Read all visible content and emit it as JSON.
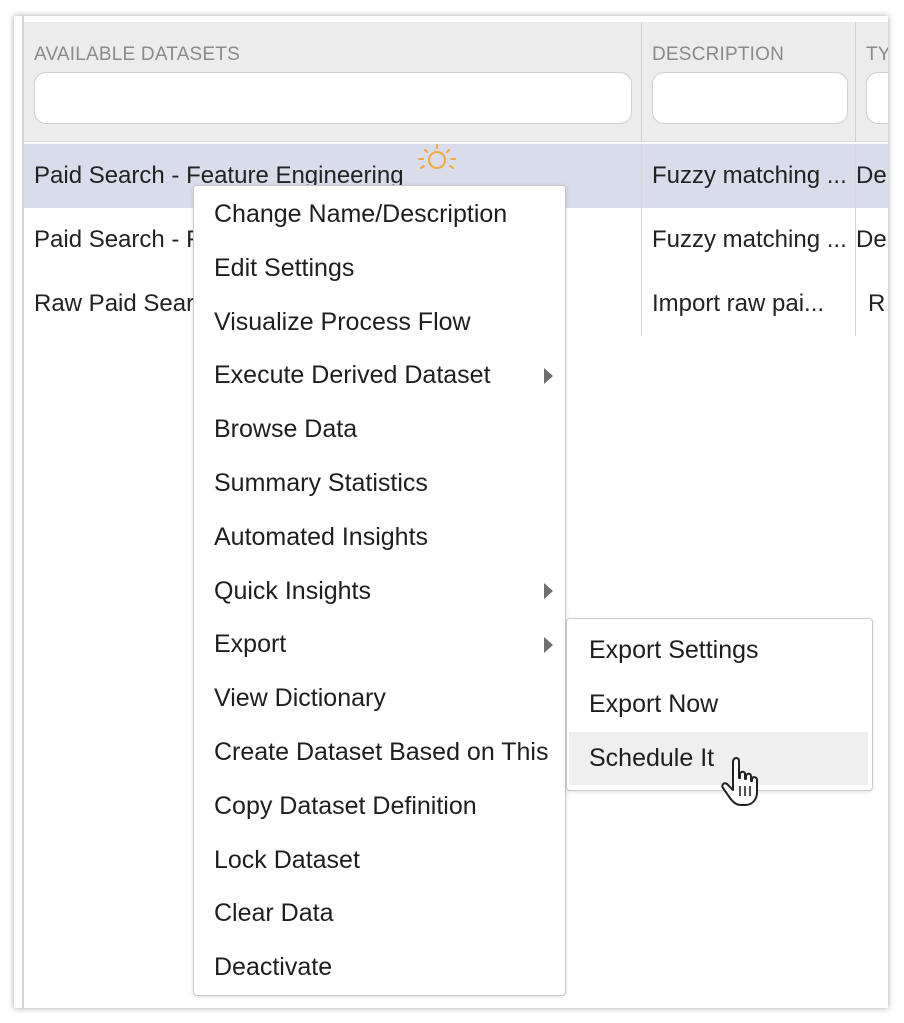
{
  "table": {
    "columns": [
      {
        "title": "AVAILABLE DATASETS",
        "filter_value": ""
      },
      {
        "title": "DESCRIPTION",
        "filter_value": ""
      },
      {
        "title": "TY",
        "filter_value": ""
      }
    ],
    "rows": [
      {
        "name": "Paid Search - Feature Engineering",
        "description": "Fuzzy matching ...",
        "type": "De",
        "selected": true,
        "icon": "lightbulb-icon"
      },
      {
        "name": "Paid Search - F",
        "description": "Fuzzy matching ...",
        "type": "De",
        "selected": false
      },
      {
        "name": "Raw Paid Sear",
        "description": "Import raw pai...",
        "type": "R",
        "selected": false
      }
    ]
  },
  "context_menu": {
    "items": [
      {
        "label": "Change Name/Description"
      },
      {
        "label": "Edit Settings"
      },
      {
        "label": "Visualize Process Flow"
      },
      {
        "label": "Execute Derived Dataset",
        "has_submenu": true
      },
      {
        "label": "Browse Data"
      },
      {
        "label": "Summary Statistics"
      },
      {
        "label": "Automated Insights"
      },
      {
        "label": "Quick Insights",
        "has_submenu": true
      },
      {
        "label": "Export",
        "has_submenu": true
      },
      {
        "label": "View Dictionary"
      },
      {
        "label": "Create Dataset Based on This"
      },
      {
        "label": "Copy Dataset Definition"
      },
      {
        "label": "Lock Dataset"
      },
      {
        "label": "Clear Data"
      },
      {
        "label": "Deactivate"
      }
    ]
  },
  "export_submenu": {
    "items": [
      {
        "label": "Export Settings"
      },
      {
        "label": "Export Now"
      },
      {
        "label": "Schedule It",
        "hovered": true
      }
    ]
  },
  "colors": {
    "selected_row": "#d9dcea",
    "header_bg": "#ececec",
    "bulb": "#f2a93b",
    "hover_item": "#efefef"
  }
}
